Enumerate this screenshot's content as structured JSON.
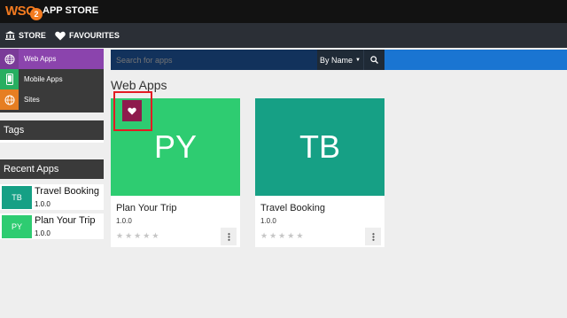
{
  "header": {
    "logo_text": "WSO",
    "logo_sub": "2",
    "title": "APP STORE"
  },
  "nav": {
    "store_label": "STORE",
    "favourites_label": "FAVOURITES"
  },
  "sidebar": {
    "menu": [
      {
        "label": "Web Apps",
        "icon": "globe-icon",
        "active": true
      },
      {
        "label": "Mobile Apps",
        "icon": "mobile-icon",
        "active": false
      },
      {
        "label": "Sites",
        "icon": "globe-icon",
        "active": false
      }
    ],
    "tags_header": "Tags",
    "recent_header": "Recent Apps",
    "recent_apps": [
      {
        "thumb": "TB",
        "name": "Travel Booking",
        "version": "1.0.0",
        "color": "#16a085"
      },
      {
        "thumb": "PY",
        "name": "Plan Your Trip",
        "version": "1.0.0",
        "color": "#2ecc71"
      }
    ]
  },
  "search": {
    "placeholder": "Search for apps",
    "sort_label": "By Name"
  },
  "main": {
    "section_title": "Web Apps",
    "apps": [
      {
        "initials": "PY",
        "name": "Plan Your Trip",
        "version": "1.0.0",
        "color": "#2ecc71",
        "rating": 0
      },
      {
        "initials": "TB",
        "name": "Travel Booking",
        "version": "1.0.0",
        "color": "#16a085",
        "rating": 0
      }
    ]
  },
  "colors": {
    "accent_purple": "#8b44ad",
    "search_bar": "#1a75d2",
    "favourite": "#8e1b4d",
    "highlight": "#e31b23"
  }
}
